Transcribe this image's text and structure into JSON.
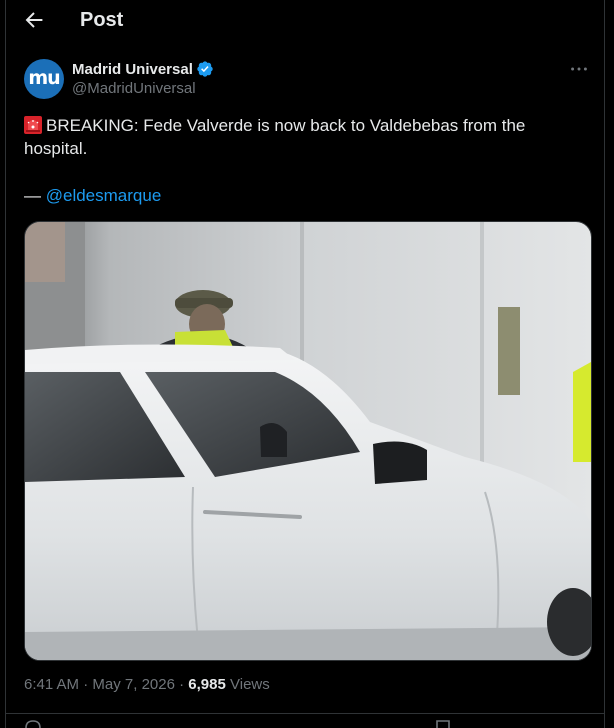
{
  "header": {
    "title": "Post",
    "back_icon": "arrow-left-icon"
  },
  "author": {
    "avatar_text": "mu",
    "display_name": "Madrid Universal",
    "handle": "@MadridUniversal",
    "verified": true,
    "avatar_color": "#1b6fb8"
  },
  "post": {
    "text": "BREAKING: Fede Valverde is now back to Valdebebas from the hospital.",
    "credit_prefix": "— ",
    "credit_handle": "@eldesmarque",
    "emoji": "rotating-light-icon"
  },
  "media": {
    "type": "video-still",
    "description_icon": "video-thumbnail"
  },
  "meta": {
    "time": "6:41 AM",
    "separator": "·",
    "date": "May 7, 2026",
    "views_count": "6,985",
    "views_label": "Views"
  },
  "colors": {
    "background": "#000000",
    "text": "#e7e9ea",
    "muted": "#71767b",
    "link": "#1d9bf0",
    "border": "#2f3336"
  }
}
